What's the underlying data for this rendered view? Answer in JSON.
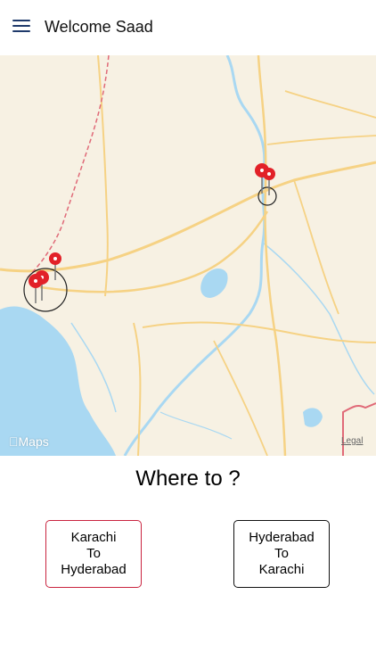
{
  "header": {
    "title": "Welcome Saad",
    "menu_icon": "hamburger-menu-icon"
  },
  "map": {
    "attribution_logo": "Maps",
    "legal_label": "Legal",
    "colors": {
      "land": "#f7f1e3",
      "water": "#a9d8f2",
      "road": "#f6d284",
      "border": "#e06a78"
    },
    "pin_icon": "map-pin-icon"
  },
  "prompt": "Where to ?",
  "routes": [
    {
      "from": "Karachi",
      "connector": "To",
      "to": "Hyderabad",
      "border_color": "#c9243f"
    },
    {
      "from": "Hyderabad",
      "connector": "To",
      "to": "Karachi",
      "border_color": "#111111"
    }
  ]
}
